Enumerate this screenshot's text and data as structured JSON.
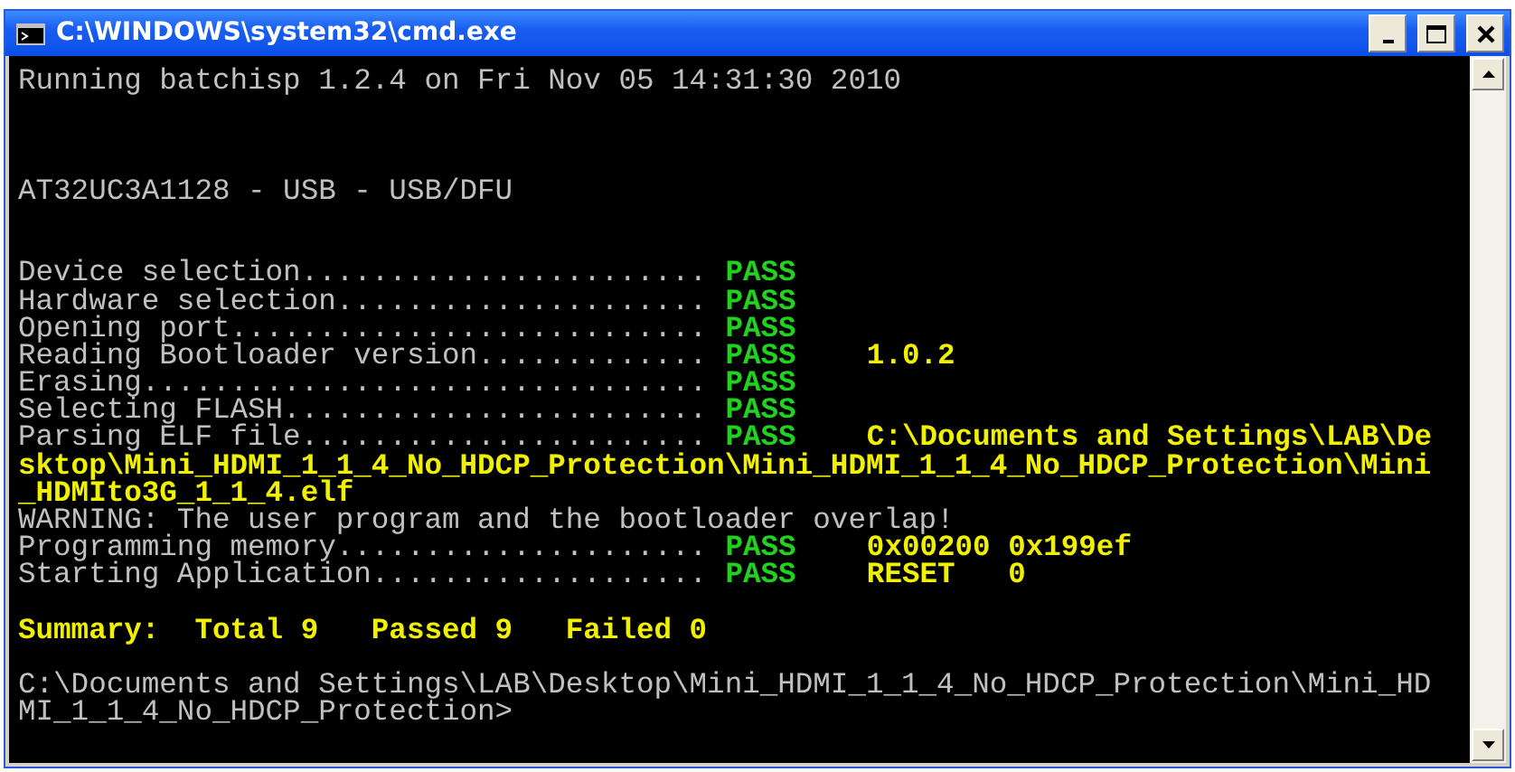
{
  "window": {
    "title": "C:\\WINDOWS\\system32\\cmd.exe"
  },
  "console": {
    "lines": [
      {
        "kind": "text",
        "segments": [
          {
            "kind": "plain",
            "text": "Running batchisp 1.2.4 on Fri Nov 05 14:31:30 2010"
          }
        ]
      },
      {
        "kind": "blank"
      },
      {
        "kind": "blank"
      },
      {
        "kind": "blank"
      },
      {
        "kind": "text",
        "segments": [
          {
            "kind": "plain",
            "text": "AT32UC3A1128 - USB - USB/DFU"
          }
        ]
      },
      {
        "kind": "blank"
      },
      {
        "kind": "blank"
      },
      {
        "kind": "text",
        "segments": [
          {
            "kind": "label",
            "text": "Device selection......................."
          },
          {
            "kind": "pass",
            "text": "PASS"
          }
        ]
      },
      {
        "kind": "text",
        "segments": [
          {
            "kind": "label",
            "text": "Hardware selection....................."
          },
          {
            "kind": "pass",
            "text": "PASS"
          }
        ]
      },
      {
        "kind": "text",
        "segments": [
          {
            "kind": "label",
            "text": "Opening port..........................."
          },
          {
            "kind": "pass",
            "text": "PASS"
          }
        ]
      },
      {
        "kind": "text",
        "segments": [
          {
            "kind": "label",
            "text": "Reading Bootloader version............."
          },
          {
            "kind": "pass",
            "text": "PASS"
          },
          {
            "kind": "value",
            "text": "1.0.2"
          }
        ]
      },
      {
        "kind": "text",
        "segments": [
          {
            "kind": "label",
            "text": "Erasing................................"
          },
          {
            "kind": "pass",
            "text": "PASS"
          }
        ]
      },
      {
        "kind": "text",
        "segments": [
          {
            "kind": "label",
            "text": "Selecting FLASH........................"
          },
          {
            "kind": "pass",
            "text": "PASS"
          }
        ]
      },
      {
        "kind": "text",
        "segments": [
          {
            "kind": "label",
            "text": "Parsing ELF file......................."
          },
          {
            "kind": "pass",
            "text": "PASS"
          },
          {
            "kind": "value",
            "text": "C:\\Documents and Settings\\LAB\\De"
          }
        ]
      },
      {
        "kind": "text",
        "segments": [
          {
            "kind": "value",
            "text": "sktop\\Mini_HDMI_1_1_4_No_HDCP_Protection\\Mini_HDMI_1_1_4_No_HDCP_Protection\\Mini"
          }
        ]
      },
      {
        "kind": "text",
        "segments": [
          {
            "kind": "value",
            "text": "_HDMIto3G_1_1_4.elf"
          }
        ]
      },
      {
        "kind": "text",
        "segments": [
          {
            "kind": "plain",
            "text": "WARNING: The user program and the bootloader overlap!"
          }
        ]
      },
      {
        "kind": "text",
        "segments": [
          {
            "kind": "label",
            "text": "Programming memory....................."
          },
          {
            "kind": "pass",
            "text": "PASS"
          },
          {
            "kind": "value",
            "text": "0x00200 0x199ef"
          }
        ]
      },
      {
        "kind": "text",
        "segments": [
          {
            "kind": "label",
            "text": "Starting Application..................."
          },
          {
            "kind": "pass",
            "text": "PASS"
          },
          {
            "kind": "value",
            "text": "RESET   0"
          }
        ]
      },
      {
        "kind": "blank"
      },
      {
        "kind": "text",
        "segments": [
          {
            "kind": "value",
            "text": "Summary:  Total 9   Passed 9   Failed 0"
          }
        ]
      },
      {
        "kind": "blank"
      },
      {
        "kind": "text",
        "segments": [
          {
            "kind": "plain",
            "text": "C:\\Documents and Settings\\LAB\\Desktop\\Mini_HDMI_1_1_4_No_HDCP_Protection\\Mini_HD"
          }
        ]
      },
      {
        "kind": "text",
        "segments": [
          {
            "kind": "plain",
            "text": "MI_1_1_4_No_HDCP_Protection>"
          }
        ]
      }
    ]
  }
}
